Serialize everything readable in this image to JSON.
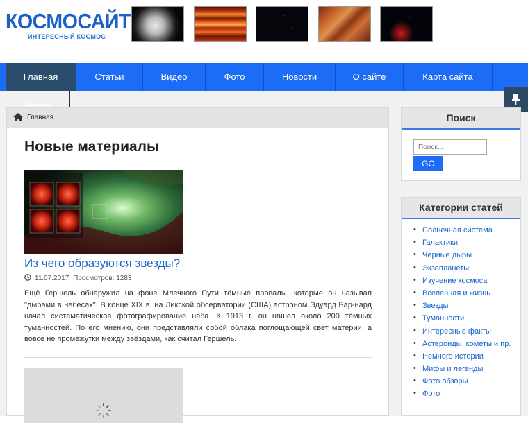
{
  "header": {
    "logo_title": "КОСМОСАЙТ",
    "logo_subtitle": "ИНТЕРЕСНЫЙ КОСМОС"
  },
  "nav": {
    "items": [
      "Главная",
      "Статьи",
      "Видео",
      "Фото",
      "Новости",
      "О сайте",
      "Карта сайта"
    ],
    "overflow_item": "Форум"
  },
  "breadcrumb": {
    "label": "Главная"
  },
  "main": {
    "section_title": "Новые материалы",
    "post": {
      "title": "Из чего образуются звезды?",
      "date": "11.07.2017",
      "views": "Просмотров: 1283",
      "excerpt": "Ещё Гершель обнаружил на фоне Млечного Пути тёмные провалы, которые он называл \"дырами в небесах\". В конце XIX в. на Ликской обсерватории (США) астроном Эдуард Бар-нард начал систематическое фотографирование неба. К 1913 г. он нашел около 200 тёмных туманностей. По его мнению, они представляли собой облака поглощающей свет материи, а вовсе не промежутки между звёздами, как считал Гершель."
    }
  },
  "sidebar": {
    "search": {
      "title": "Поиск",
      "placeholder": "Поиск...",
      "button_label": "GO"
    },
    "categories": {
      "title": "Категории статей",
      "items": [
        "Солнечная система",
        "Галактики",
        "Черные дыры",
        "Экзопланеты",
        "Изучение космоса",
        "Вселенная и жизнь",
        "Звезды",
        "Туманности",
        "Интересные факты",
        "Астероиды, кометы и пр.",
        "Немного истории",
        "Мифы и легенды",
        "Фото обзоры",
        "Фото"
      ]
    }
  },
  "colors": {
    "nav_blue": "#1d6cf5",
    "nav_active": "#2a4d6e",
    "link_blue": "#1666cc"
  }
}
